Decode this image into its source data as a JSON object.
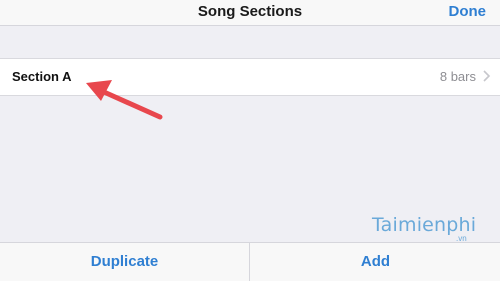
{
  "nav": {
    "title": "Song Sections",
    "done_label": "Done"
  },
  "sections": [
    {
      "label": "Section A",
      "detail": "8 bars"
    }
  ],
  "toolbar": {
    "duplicate_label": "Duplicate",
    "add_label": "Add"
  },
  "watermark": {
    "brand": "Taimienphi",
    "domain": ".vn"
  },
  "colors": {
    "accent": "#2f7fd2",
    "annotation_arrow": "#e8474d",
    "background": "#efeff4"
  },
  "icons": {
    "row_chevron": "chevron-right-icon",
    "annotation": "red-arrow-icon"
  }
}
